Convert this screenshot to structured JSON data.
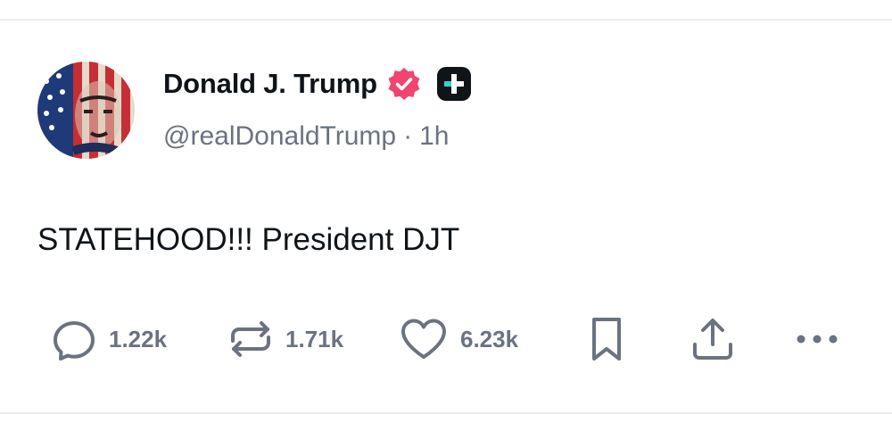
{
  "post": {
    "display_name": "Donald J. Trump",
    "handle": "@realDonaldTrump",
    "separator": "·",
    "timestamp": "1h",
    "text": "STATEHOOD!!! President DJT"
  },
  "badges": {
    "verified_icon": "verified-badge-icon",
    "verified_color": "#f0456f",
    "plus_icon": "plus-badge-icon",
    "plus_color": "#0f1419"
  },
  "actions": {
    "reply": {
      "icon": "comment-icon",
      "count": "1.22k"
    },
    "repost": {
      "icon": "repost-icon",
      "count": "1.71k"
    },
    "like": {
      "icon": "heart-icon",
      "count": "6.23k"
    },
    "bookmark": {
      "icon": "bookmark-icon"
    },
    "share": {
      "icon": "share-icon"
    },
    "more": {
      "icon": "more-dots-icon"
    }
  },
  "colors": {
    "text": "#0f1419",
    "muted": "#6b7280",
    "divider": "#ececef"
  }
}
